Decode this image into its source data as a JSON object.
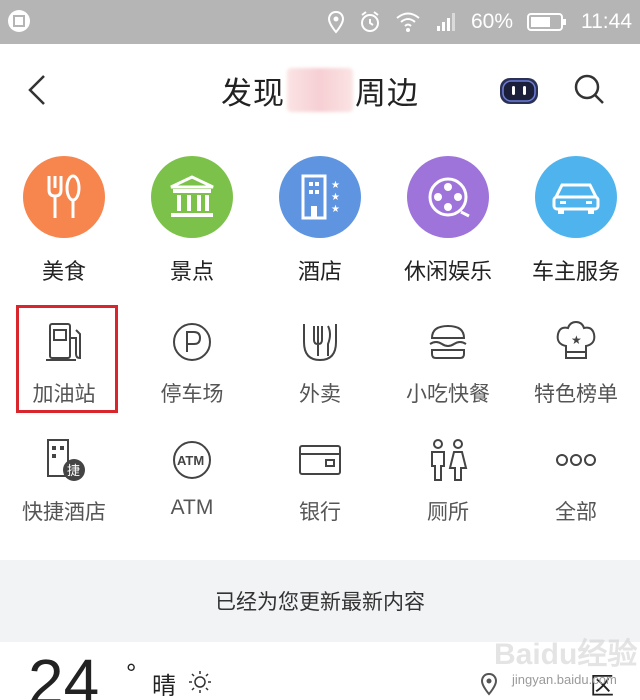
{
  "status_bar": {
    "battery": "60%",
    "time": "11:44"
  },
  "header": {
    "title_prefix": "发现",
    "title_suffix": "周边"
  },
  "categories": [
    {
      "label": "美食",
      "icon": "fork-spoon-icon",
      "color": "#f7854e"
    },
    {
      "label": "景点",
      "icon": "temple-icon",
      "color": "#7cc24a"
    },
    {
      "label": "酒店",
      "icon": "hotel-icon",
      "color": "#5f95e0"
    },
    {
      "label": "休闲娱乐",
      "icon": "film-reel-icon",
      "color": "#9e74db"
    },
    {
      "label": "车主服务",
      "icon": "car-icon",
      "color": "#4fb4ee"
    }
  ],
  "services_row1": [
    {
      "label": "加油站",
      "icon": "gas-station-icon"
    },
    {
      "label": "停车场",
      "icon": "parking-icon"
    },
    {
      "label": "外卖",
      "icon": "takeout-icon"
    },
    {
      "label": "小吃快餐",
      "icon": "burger-icon"
    },
    {
      "label": "特色榜单",
      "icon": "chef-hat-icon"
    }
  ],
  "services_row2": [
    {
      "label": "快捷酒店",
      "icon": "express-hotel-icon",
      "badge": "捷"
    },
    {
      "label": "ATM",
      "icon": "atm-icon",
      "badge": "ATM"
    },
    {
      "label": "银行",
      "icon": "bank-card-icon"
    },
    {
      "label": "厕所",
      "icon": "restroom-icon"
    },
    {
      "label": "全部",
      "icon": "more-dots-icon"
    }
  ],
  "update_banner": "已经为您更新最新内容",
  "weather": {
    "temp": "24",
    "degree": "°",
    "condition": "晴",
    "district": "区"
  },
  "watermark": {
    "brand": "Baidu经验",
    "url": "jingyan.baidu.com"
  },
  "colors": {
    "accent_red": "#d9262c",
    "status_bar": "#b5b5b5",
    "band": "#f2f3f5"
  }
}
